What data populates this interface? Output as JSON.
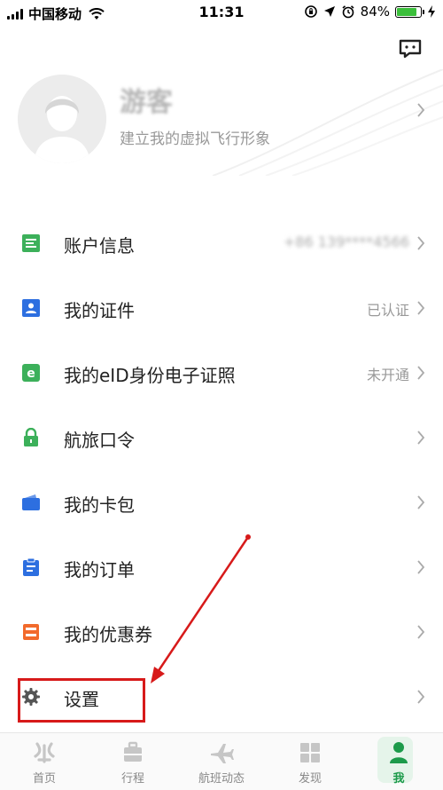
{
  "status_bar": {
    "carrier": "中国移动",
    "time": "11:31",
    "battery_percent": "84%",
    "battery_level": 0.84
  },
  "profile": {
    "name": "游客",
    "subtitle": "建立我的虚拟飞行形象"
  },
  "menu": [
    {
      "label": "账户信息",
      "value": "+86 139****4566",
      "icon": "account-info-icon",
      "color": "#3cb05a"
    },
    {
      "label": "我的证件",
      "value": "已认证",
      "icon": "id-card-icon",
      "color": "#2d6fe0"
    },
    {
      "label": "我的eID身份电子证照",
      "value": "未开通",
      "icon": "eid-icon",
      "color": "#3cb05a"
    },
    {
      "label": "航旅口令",
      "value": "",
      "icon": "lock-icon",
      "color": "#3cb05a"
    },
    {
      "label": "我的卡包",
      "value": "",
      "icon": "card-wallet-icon",
      "color": "#2d6fe0"
    },
    {
      "label": "我的订单",
      "value": "",
      "icon": "orders-icon",
      "color": "#2d6fe0"
    },
    {
      "label": "我的优惠券",
      "value": "",
      "icon": "coupon-icon",
      "color": "#f26a2c"
    },
    {
      "label": "设置",
      "value": "",
      "icon": "settings-gear-icon",
      "color": "#555555"
    }
  ],
  "tabs": [
    {
      "label": "首页",
      "icon": "home-icon"
    },
    {
      "label": "行程",
      "icon": "trip-icon"
    },
    {
      "label": "航班动态",
      "icon": "plane-icon"
    },
    {
      "label": "发现",
      "icon": "discover-icon"
    },
    {
      "label": "我",
      "icon": "me-icon",
      "active": true
    }
  ],
  "colors": {
    "accent": "#1c9a4a",
    "annotation": "#d71a1a"
  }
}
